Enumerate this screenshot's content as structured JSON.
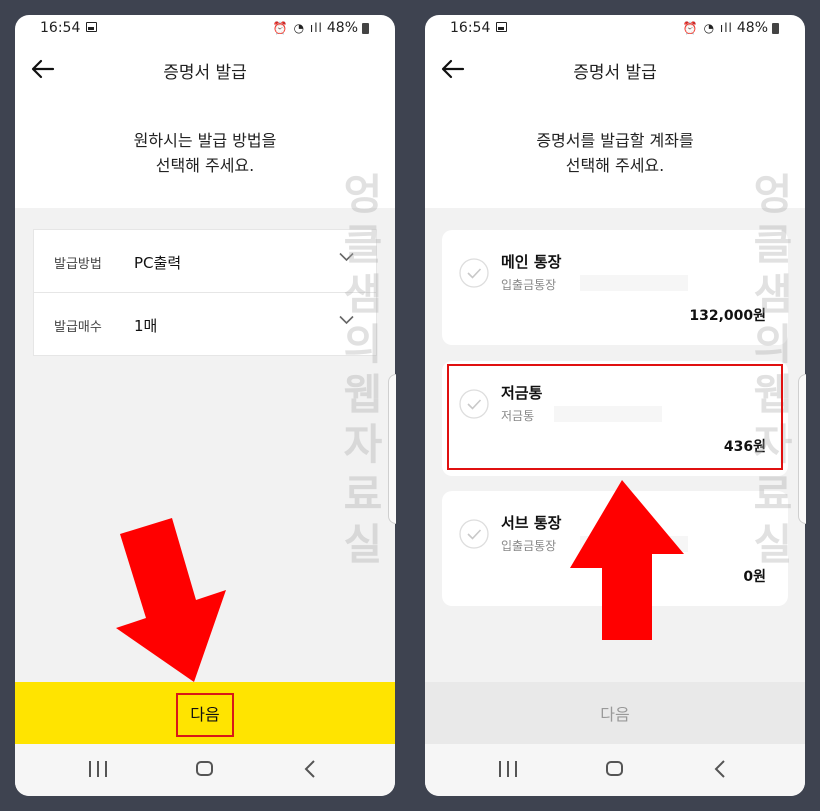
{
  "left_screen": {
    "status": {
      "time": "16:54",
      "battery": "48%"
    },
    "header": {
      "title": "증명서 발급"
    },
    "prompt": {
      "line1": "원하시는 발급 방법을",
      "line2": "선택해 주세요."
    },
    "form": {
      "rows": [
        {
          "label": "발급방법",
          "value": "PC출력"
        },
        {
          "label": "발급매수",
          "value": "1매"
        }
      ]
    },
    "next_button": "다음"
  },
  "right_screen": {
    "status": {
      "time": "16:54",
      "battery": "48%"
    },
    "header": {
      "title": "증명서 발급"
    },
    "prompt": {
      "line1": "증명서를 발급할 계좌를",
      "line2": "선택해 주세요."
    },
    "accounts": [
      {
        "name": "메인 통장",
        "type": "입출금통장",
        "balance": "132,000원"
      },
      {
        "name": "저금통",
        "type": "저금통",
        "balance": "436원"
      },
      {
        "name": "서브 통장",
        "type": "입출금통장",
        "balance": "0원"
      }
    ],
    "next_button": "다음"
  },
  "watermark": "엉클샘의웹자료실",
  "colors": {
    "accent_yellow": "#ffe400",
    "highlight_red": "#e01010",
    "arrow_red": "#ff0000",
    "background": "#3e4350",
    "content_gray": "#f2f2f2"
  },
  "icons": {
    "status_left": "gallery-icon",
    "status_right": [
      "alarm-icon",
      "wifi-icon",
      "signal-icon",
      "battery-icon"
    ],
    "header": "back-arrow-icon",
    "form": "chevron-down-icon",
    "account": "check-circle-icon",
    "nav": [
      "recent-apps-icon",
      "home-icon",
      "nav-back-icon"
    ]
  }
}
